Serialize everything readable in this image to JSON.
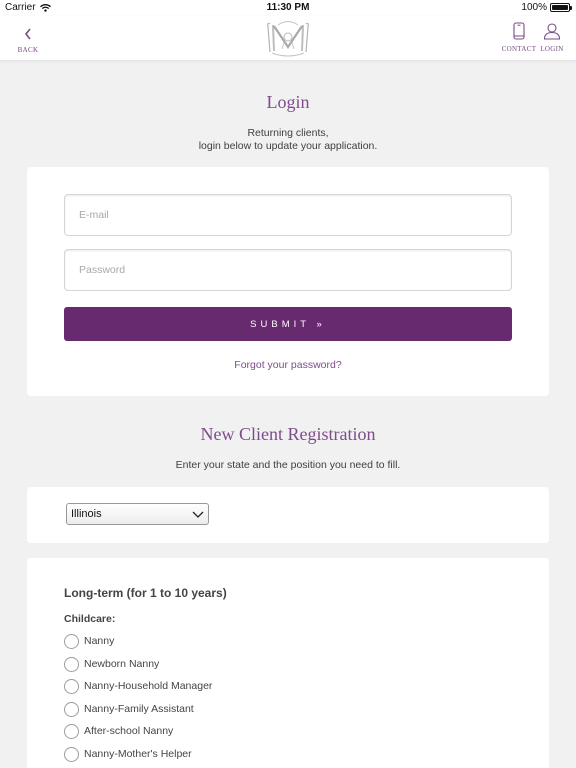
{
  "status_bar": {
    "carrier": "Carrier",
    "time": "11:30 PM",
    "battery": "100%"
  },
  "nav": {
    "back_label": "BACK",
    "contact_label": "CONTACT",
    "login_label": "LOGIN",
    "accent_color": "#7a4a86"
  },
  "login": {
    "title": "Login",
    "subtitle_line1": "Returning clients,",
    "subtitle_line2": "login below to update your application.",
    "email_placeholder": "E-mail",
    "password_placeholder": "Password",
    "submit_label": "SUBMIT »",
    "forgot_link": "Forgot your password?",
    "button_color": "#682a6f"
  },
  "registration": {
    "title": "New Client Registration",
    "subtitle": "Enter your state and the position you need to fill.",
    "state_selected": "Illinois",
    "section_heading": "Long-term (for 1 to 10 years)",
    "group_label": "Childcare:",
    "options": [
      {
        "label": "Nanny"
      },
      {
        "label": "Newborn Nanny"
      },
      {
        "label": "Nanny-Household Manager"
      },
      {
        "label": "Nanny-Family Assistant"
      },
      {
        "label": "After-school Nanny"
      },
      {
        "label": "Nanny-Mother's Helper"
      }
    ]
  }
}
